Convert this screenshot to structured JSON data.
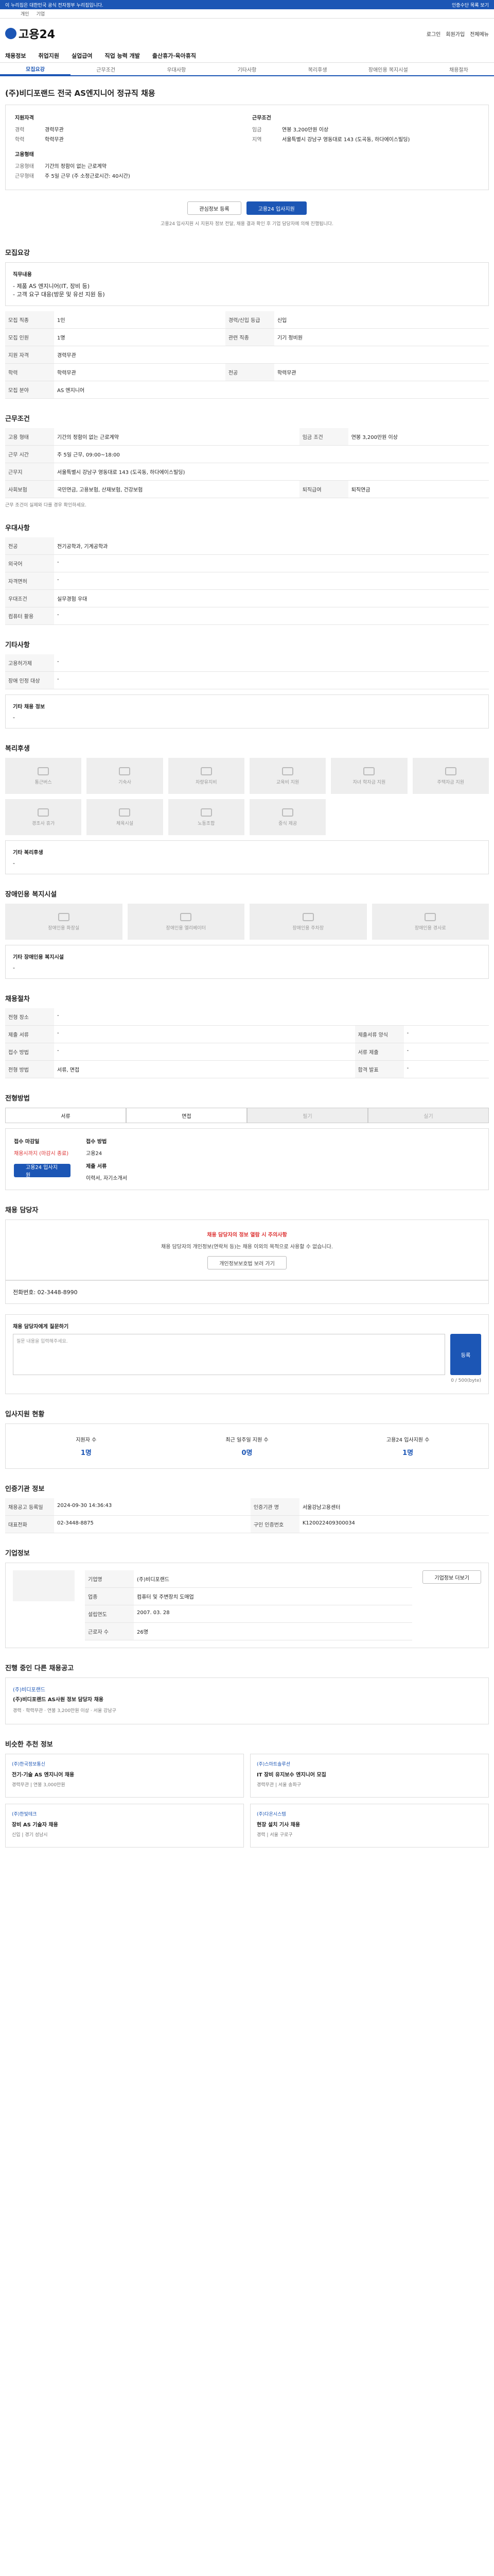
{
  "topbar": {
    "notice": "이 누리집은 대한민국 공식 전자정부 누리집입니다.",
    "right": [
      "인증수단 목록 보기",
      "로그인",
      "회원가입",
      "개인 회원"
    ]
  },
  "util": [
    "개인",
    "기업"
  ],
  "header": {
    "logo": "고용24",
    "right": [
      "로그인",
      "회원가입",
      "전체메뉴"
    ]
  },
  "gnb": [
    "채용정보",
    "취업지원",
    "실업급여",
    "직업 능력 개발",
    "출산휴가·육아휴직"
  ],
  "tabs": [
    "모집요강",
    "근무조건",
    "우대사항",
    "기타사항",
    "복리후생",
    "장애인용 복지시설",
    "채용절차",
    "전형방법",
    "채용 담당자",
    "입사지원 현황",
    "인증기관 정보",
    "기업정보"
  ],
  "job": {
    "company": "(주)비디포랜드",
    "title": "(주)비디포랜드 전국 AS엔지니어 정규직 채용",
    "left_head": "지원자격",
    "exp_k": "경력",
    "exp_v": "경력무관",
    "edu_k": "학력",
    "edu_v": "학력무관",
    "form_head": "고용형태",
    "form_k": "고용형태",
    "form_v": "기간의 정함이 없는 근로계약",
    "wage_k": "근무형태",
    "wage_v": "주 5일 근무 (주 소정근로시간: 40시간)",
    "right_head": "근무조건",
    "pay_k": "임금",
    "pay_v": "연봉 3,200만원 이상",
    "loc_k": "지역",
    "loc_v": "서울특별시 강남구 영동대로 143 (도곡동, 하다에이스빌딩)"
  },
  "buttons": {
    "interest": "관심정보 등록",
    "apply": "고용24 입사지원"
  },
  "apply_note": "고용24 입사지원 시 지원자 정보 전달, 채용 결과 확인 후 기업 담당자에 의해 진행됩니다.",
  "sections": {
    "recruit": "모집요강",
    "work": "근무조건",
    "prefer": "우대사항",
    "etc": "기타사항",
    "welfare": "복리후생",
    "disabled": "장애인용 복지시설",
    "process": "채용절차",
    "method": "전형방법",
    "manager": "채용 담당자",
    "status": "입사지원 현황",
    "cert": "인증기관 정보",
    "company": "기업정보",
    "other_jobs": "진행 중인 다른 채용공고",
    "similar": "비슷한 추천 정보"
  },
  "recruit": {
    "duty_head": "직무내용",
    "duty_lines": [
      "- 제품 AS 엔지니어(IT, 장비 등)",
      "- 고객 요구 대응(방문 및 유선 지원 등)"
    ],
    "rows": [
      [
        "모집 직종",
        "1인",
        "경력/신입 등급",
        "신입"
      ],
      [
        "모집 인원",
        "1명",
        "관련 직종",
        "기기 정비원"
      ],
      [
        "지원 자격",
        "경력무관",
        "",
        ""
      ],
      [
        "학력",
        "학력무관",
        "전공",
        "학력무관"
      ],
      [
        "모집 분야",
        "AS 엔지니어",
        "",
        ""
      ]
    ]
  },
  "work": {
    "rows": [
      [
        "고용 형태",
        "기간의 정함이 없는 근로계약",
        "임금 조건",
        "연봉 3,200만원 이상"
      ],
      [
        "근무 시간",
        "주 5일 근무, 09:00~18:00",
        "",
        ""
      ],
      [
        "근무지",
        "서울특별시 강남구 영동대로 143 (도곡동, 하다에이스빌딩)",
        "",
        ""
      ],
      [
        "사회보험",
        "국민연금, 고용보험, 산재보험, 건강보험",
        "퇴직급여",
        "퇴직연금"
      ]
    ],
    "note": "근무 조건이 실제와 다를 경우 확인하세요."
  },
  "prefer": {
    "rows": [
      [
        "전공",
        "전기공학과, 기계공학과"
      ],
      [
        "외국어",
        "-"
      ],
      [
        "자격면허",
        "-"
      ],
      [
        "우대조건",
        "실무경험 우대"
      ],
      [
        "컴퓨터 활용",
        "-"
      ]
    ]
  },
  "etc": {
    "rows": [
      [
        "고용허가제",
        "-"
      ],
      [
        "장애 인정 대상",
        "-"
      ]
    ],
    "extra_head": "기타 채용 정보",
    "extra": "-"
  },
  "welfare": {
    "items": [
      "통근버스",
      "기숙사",
      "차량유지비",
      "교육비 지원",
      "자녀 학자금 지원",
      "주택자금 지원",
      "경조사 휴가",
      "체육시설",
      "노동조합",
      "중식 제공",
      "",
      ""
    ],
    "extra_head": "기타 복리후생",
    "extra": "-"
  },
  "disabled": {
    "items": [
      "장애인용 화장실",
      "장애인용 엘리베이터",
      "장애인용 주차장",
      "장애인용 경사로"
    ],
    "extra_head": "기타 장애인용 복지시설",
    "extra": "-"
  },
  "process": {
    "rows": [
      [
        "전형 장소",
        "-"
      ],
      [
        "제출 서류",
        "-",
        "제출서류 양식",
        "-"
      ],
      [
        "접수 방법",
        "-",
        "서류 제출",
        "-"
      ],
      [
        "전형 방법",
        "서류, 면접",
        "합격 발표",
        "-"
      ]
    ]
  },
  "method": {
    "steps": [
      "서류",
      "면접",
      "필기",
      "실기"
    ],
    "apply_head": "접수 마감일",
    "apply_v": "채용시까지 (마감시 종료)",
    "method_head": "접수 방법",
    "method_v": "고용24",
    "docs_head": "제출 서류",
    "docs_v": "이력서, 자기소개서",
    "apply_btn": "고용24 입사지원"
  },
  "manager": {
    "warn_title": "채용 담당자의 정보 열람 시 주의사항",
    "warn_text": "채용 담당자의 개인정보(연락처 등)는 채용 이외의 목적으로 사용할 수 없습니다.",
    "btn": "개인정보보호법 보러 가기",
    "contact": "전화번호: 02-3448-8990"
  },
  "question": {
    "head": "채용 담당자에게 질문하기",
    "placeholder": "질문 내용을 입력해주세요.",
    "counter": "0 / 500(byte)",
    "submit": "등록"
  },
  "status": {
    "labels": [
      "지원자 수",
      "최근 일주일 지원 수",
      "고용24 입사지원 수"
    ],
    "values": [
      "1명",
      "0명",
      "1명"
    ],
    "more": "더보기"
  },
  "cert": {
    "rows": [
      [
        "채용공고 등록일",
        "2024-09-30 14:36:43",
        "인증기관 명",
        "서울강남고용센터"
      ],
      [
        "대표전화",
        "02-3448-8875",
        "구인 인증번호",
        "K120022409300034"
      ]
    ]
  },
  "company": {
    "rows": [
      [
        "기업명",
        "(주)비디포랜드"
      ],
      [
        "업종",
        "컴퓨터 및 주변장치 도매업"
      ],
      [
        "설립연도",
        "2007. 03. 28"
      ],
      [
        "근로자 수",
        "26명"
      ],
      [
        "매출액",
        "-"
      ]
    ],
    "btn": "기업정보 더보기"
  },
  "other": {
    "company": "(주)비디포랜드",
    "title": "(주)비디포랜드 AS사원 정보 담당자 채용",
    "meta": [
      "경력",
      "학력무관",
      "연봉 3,200만원 이상",
      "서울 강남구"
    ]
  },
  "similar": [
    {
      "c": "(주)한국정보통신",
      "t": "전기·기술 AS 엔지니어 채용",
      "m": "경력무관 | 연봉 3,000만원"
    },
    {
      "c": "(주)스마트솔루션",
      "t": "IT 장비 유지보수 엔지니어 모집",
      "m": "경력무관 | 서울 송파구"
    },
    {
      "c": "(주)한빛테크",
      "t": "장비 AS 기술자 채용",
      "m": "신입 | 경기 성남시"
    },
    {
      "c": "(주)다온시스템",
      "t": "현장 설치 기사 채용",
      "m": "경력 | 서울 구로구"
    }
  ]
}
